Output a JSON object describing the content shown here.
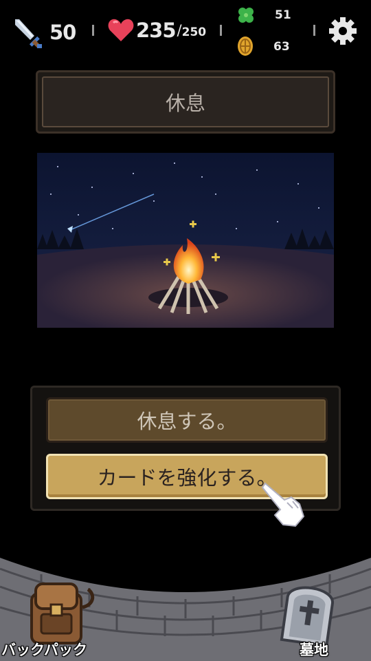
{
  "hud": {
    "attack": "50",
    "hp_current": "235",
    "hp_slash": "/",
    "hp_max": "250",
    "clover_count": "51",
    "coin_count": "63",
    "icons": [
      "sword-icon",
      "heart-icon",
      "clover-icon",
      "coin-icon",
      "gear-icon"
    ]
  },
  "event": {
    "title": "休息"
  },
  "choices": {
    "rest_label": "休息する。",
    "upgrade_label": "カードを強化する。"
  },
  "bottom": {
    "backpack_label": "バックパック",
    "graveyard_label": "墓地"
  },
  "colors": {
    "button_highlight": "#c8a55c",
    "button_dim": "#5e4a2c",
    "heart": "#e8425a"
  }
}
